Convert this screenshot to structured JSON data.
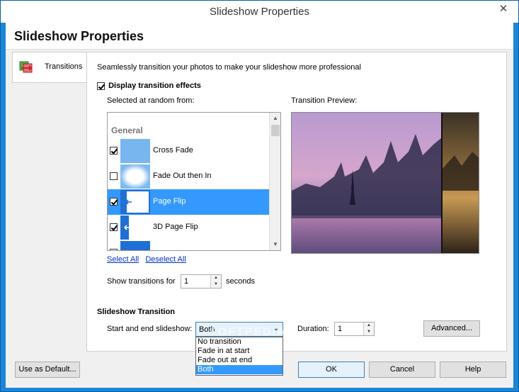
{
  "window": {
    "title": "Slideshow Properties",
    "close_glyph": "✕"
  },
  "header": {
    "title": "Slideshow Properties"
  },
  "nav": {
    "tab_label": "Transitions",
    "tab_icon": "transitions-icon"
  },
  "transitions": {
    "description": "Seamlessly transition your photos to make your slideshow more professional",
    "display_effects_label": "Display transition effects",
    "display_effects_checked": true,
    "random_label": "Selected at random from:",
    "group_label": "General",
    "items": [
      {
        "label": "Cross Fade",
        "checked": true,
        "selected": false
      },
      {
        "label": "Fade Out then In",
        "checked": false,
        "selected": false
      },
      {
        "label": "Page Flip",
        "checked": true,
        "selected": true
      },
      {
        "label": "3D Page Flip",
        "checked": true,
        "selected": false
      }
    ],
    "select_all": "Select All",
    "deselect_all": "Deselect All",
    "preview_label": "Transition Preview:",
    "show_for_label": "Show transitions for",
    "show_for_value": "1",
    "seconds_label": "seconds"
  },
  "slideshow_transition": {
    "title": "Slideshow Transition",
    "start_end_label": "Start and end slideshow:",
    "selected": "Both",
    "options": [
      "No transition",
      "Fade in at start",
      "Fade out at end",
      "Both"
    ],
    "duration_label": "Duration:",
    "duration_value": "1",
    "advanced_label": "Advanced..."
  },
  "footer": {
    "default_label": "Use as Default...",
    "ok_label": "OK",
    "cancel_label": "Cancel",
    "help_label": "Help"
  },
  "watermark": "SOFTPEDIA",
  "colors": {
    "title_bar_accent": "#1a86d8",
    "selection": "#3399ff",
    "link": "#0033cc"
  }
}
